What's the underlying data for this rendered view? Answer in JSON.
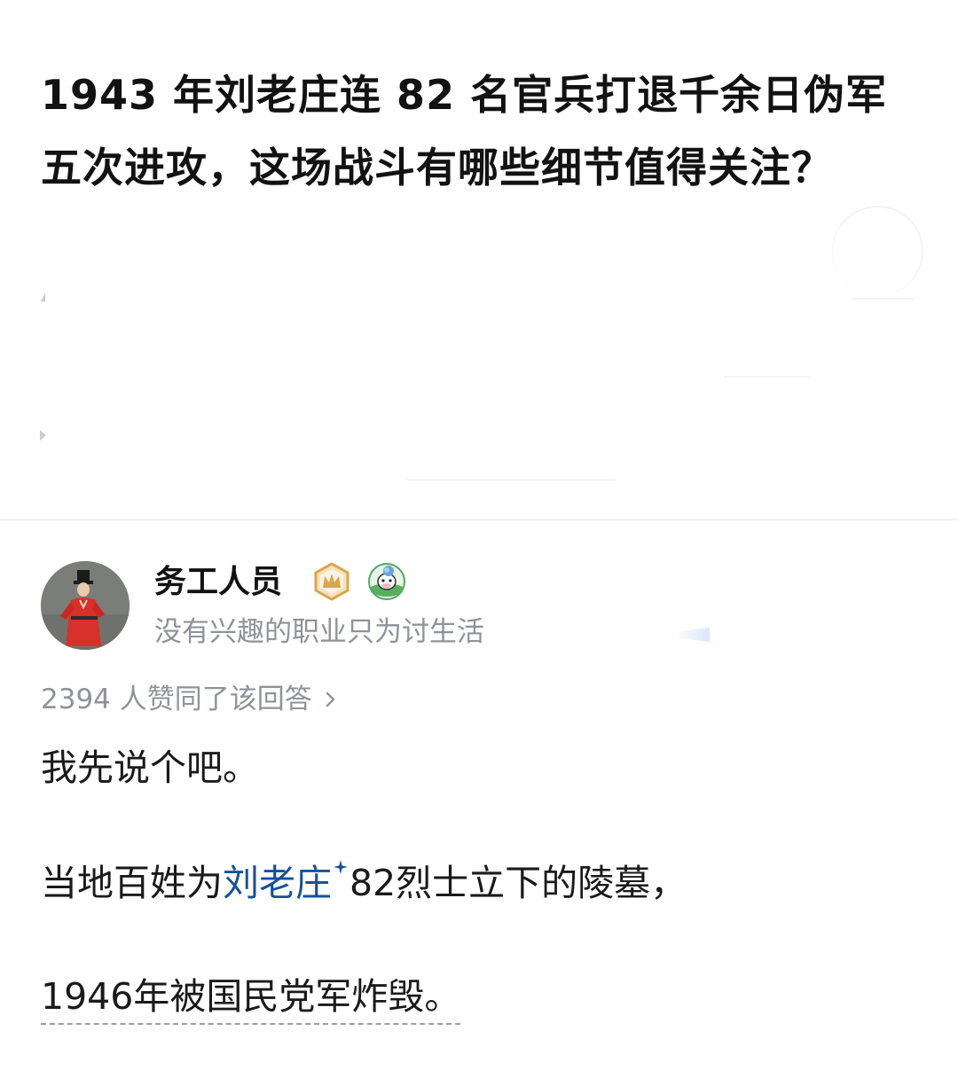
{
  "question": {
    "title": "1943 年刘老庄连 82 名官兵打退千余日伪军五次进攻，这场战斗有哪些细节值得关注？"
  },
  "author": {
    "name": "务工人员",
    "bio": "没有兴趣的职业只为讨生活",
    "badges": [
      "crown-badge-icon",
      "cow-badge-icon"
    ]
  },
  "votes": {
    "text": "2394 人赞同了该回答",
    "chevron": "chevron-right-icon"
  },
  "answer": {
    "para1": "我先说个吧。",
    "para2_before": "当地百姓为",
    "para2_link": "刘老庄",
    "para2_after": "82烈士立下的陵墓，",
    "para3": "1946年被国民党军炸毁。"
  },
  "colors": {
    "link": "#175199",
    "meta_text": "#8f9399",
    "title_text": "#121212",
    "badge_gold": "#d9a74a",
    "avatar_robe": "#d8302a"
  }
}
